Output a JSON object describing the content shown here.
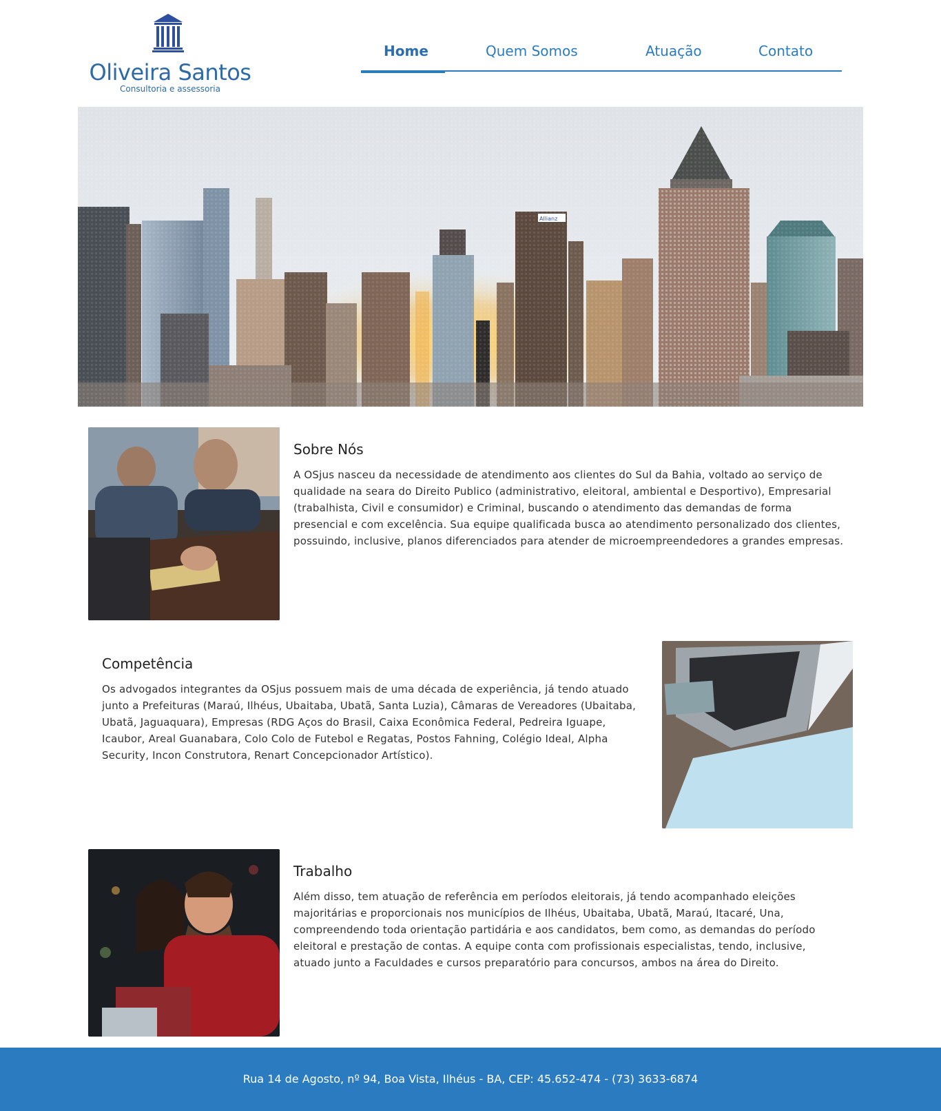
{
  "brand": {
    "name": "Oliveira Santos",
    "tagline": "Consultoria e assessoria",
    "color": "#2d6aa6"
  },
  "nav": {
    "items": [
      {
        "label": "Home",
        "active": true
      },
      {
        "label": "Quem Somos",
        "active": false
      },
      {
        "label": "Atuação",
        "active": false
      },
      {
        "label": "Contato",
        "active": false
      }
    ],
    "accent": "#2a7bbf"
  },
  "sections": [
    {
      "title": "Sobre Nós",
      "text": "A OSjus nasceu da necessidade de atendimento aos clientes do Sul da Bahia, voltado ao serviço de qualidade na seara do Direito Publico (administrativo, eleitoral, ambiental e Desportivo), Empresarial (trabalhista, Civil e consumidor) e Criminal, buscando o atendimento das demandas de forma presencial e com excelência. Sua equipe qualificada busca ao atendimento personalizado dos clientes, possuindo, inclusive, planos diferenciados para atender de microempreendedores a grandes empresas."
    },
    {
      "title": "Competência",
      "text": "Os advogados integrantes da OSjus possuem mais de uma década de experiência, já tendo atuado junto a Prefeituras (Maraú, Ilhéus, Ubaitaba, Ubatã, Santa Luzia), Câmaras de Vereadores (Ubaitaba, Ubatã, Jaguaquara), Empresas (RDG Aços do Brasil, Caixa Econômica Federal, Pedreira Iguape, Icaubor, Areal Guanabara, Colo Colo de Futebol e Regatas, Postos Fahning, Colégio Ideal, Alpha Security, Incon Construtora, Renart Concepcionador Artístico)."
    },
    {
      "title": "Trabalho",
      "text": "Além disso, tem atuação de referência em períodos eleitorais, já tendo acompanhado eleições majoritárias e proporcionais nos municípios de Ilhéus, Ubaitaba, Ubatã, Maraú, Itacaré, Una, compreendendo toda orientação partidária e aos candidatos, bem como, as demandas do período eleitoral e prestação de contas. A equipe conta com profissionais especialistas, tendo, inclusive, atuado junto a Faculdades e cursos preparatório para concursos, ambos na área do Direito."
    }
  ],
  "hero": {
    "sign": "Allianz"
  },
  "footer": {
    "text": "Rua 14 de Agosto, nº 94, Boa Vista, Ilhéus - BA, CEP: 45.652-474 - (73) 3633-6874",
    "color": "#2a7bbf"
  }
}
